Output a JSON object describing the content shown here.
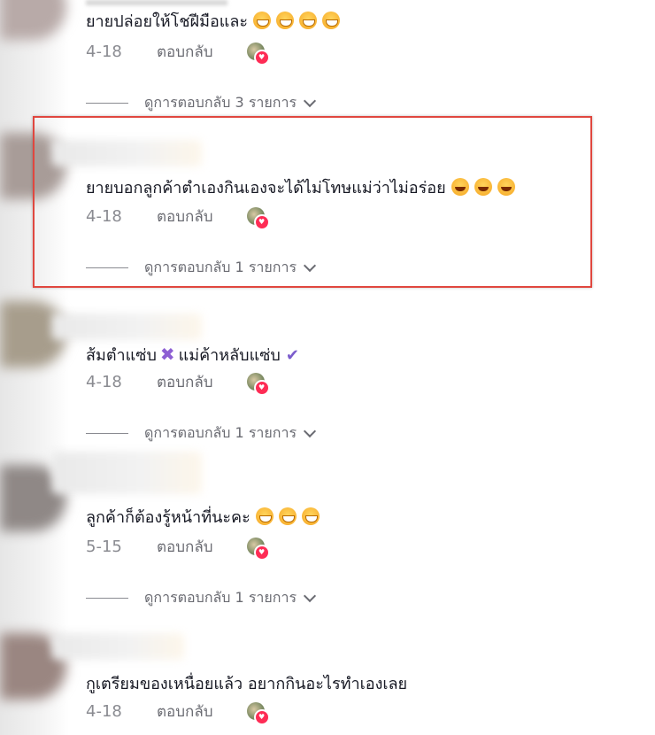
{
  "comments": [
    {
      "text": "ยายปล่อยให้โชฝีมือและ",
      "emojis": [
        "grin-emoji",
        "grin-emoji",
        "grin-emoji",
        "grin-emoji"
      ],
      "date": "4-18",
      "reply_label": "ตอบกลับ",
      "view_replies": "ดูการตอบกลับ 3 รายการ"
    },
    {
      "text": "ยายบอกลูกค้าตำเองกินเองจะได้ไม่โทษแม่ว่าไม่อร่อย",
      "emojis": [
        "laugh-emoji",
        "laugh-emoji",
        "laugh-emoji"
      ],
      "date": "4-18",
      "reply_label": "ตอบกลับ",
      "view_replies": "ดูการตอบกลับ 1 รายการ"
    },
    {
      "text_part1": "ส้มตำแซ่บ",
      "text_part2": "แม่ค้าหลับแซ่บ",
      "date": "4-18",
      "reply_label": "ตอบกลับ",
      "view_replies": "ดูการตอบกลับ 1 รายการ"
    },
    {
      "text": "ลูกค้าก็ต้องรู้หน้าที่นะคะ",
      "emojis": [
        "grin-emoji",
        "grin-emoji",
        "grin-emoji"
      ],
      "date": "5-15",
      "reply_label": "ตอบกลับ",
      "view_replies": "ดูการตอบกลับ 1 รายการ"
    },
    {
      "text": "กูเตรียมของเหนื่อยแล้ว อยากกินอะไรทำเองเลย",
      "date": "4-18",
      "reply_label": "ตอบกลับ"
    }
  ],
  "colors": {
    "highlight_border": "#e0473f",
    "like_heart": "#fe2c55",
    "secondary_text": "#8a8b91"
  }
}
